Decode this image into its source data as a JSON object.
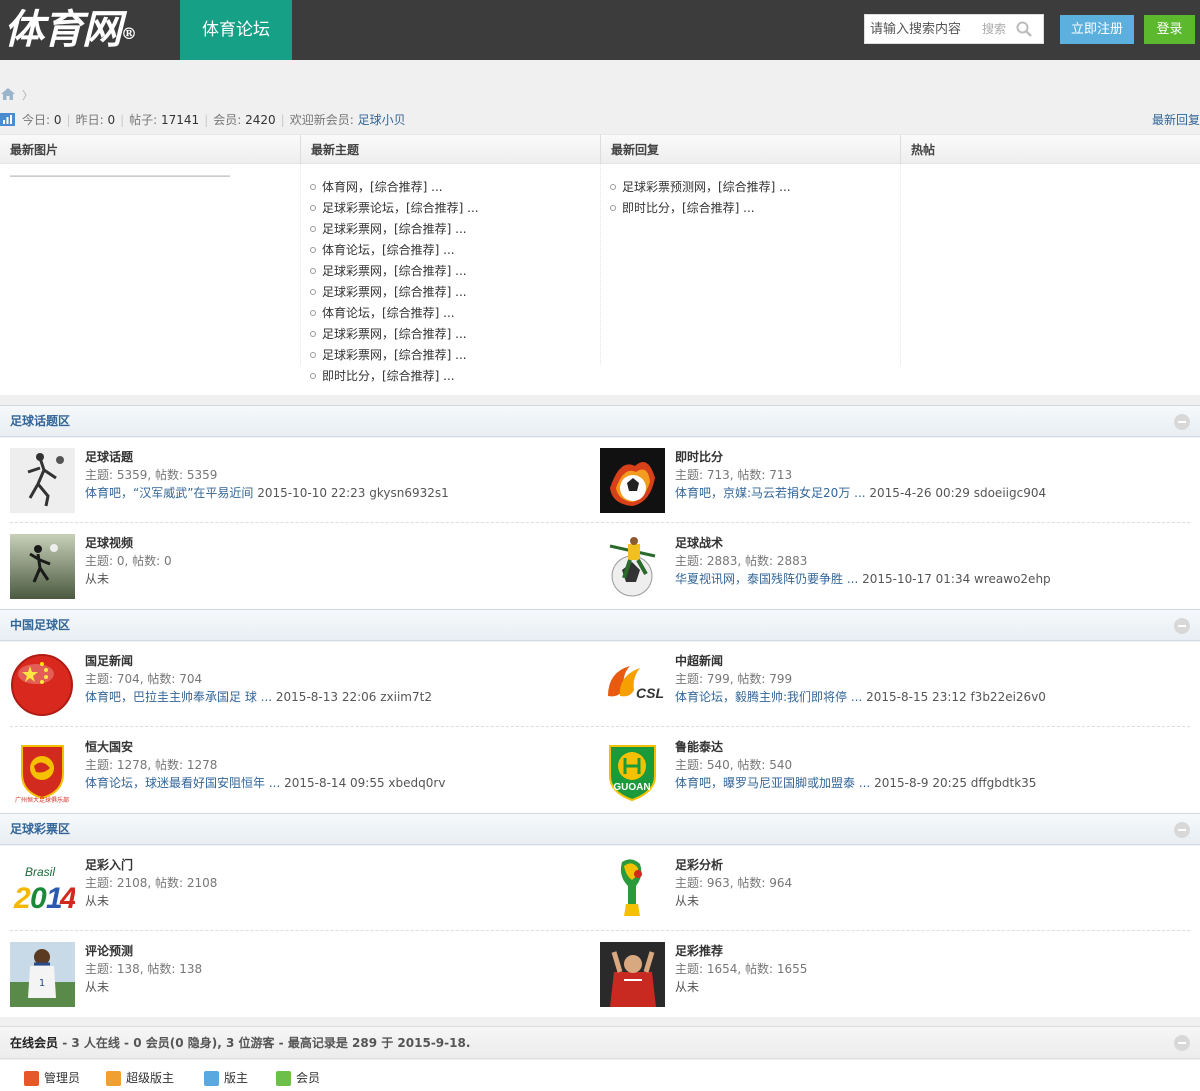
{
  "header": {
    "logo": "体育网",
    "logo_mark": "®",
    "nav_tab": "体育论坛",
    "search_placeholder": "请输入搜索内容",
    "search_label": "搜索",
    "register_label": "立即注册",
    "login_label": "登录"
  },
  "breadcrumb": {
    "separator": "〉"
  },
  "stats": {
    "today_label": "今日:",
    "today": "0",
    "yesterday_label": "昨日:",
    "yesterday": "0",
    "posts_label": "帖子:",
    "posts": "17141",
    "members_label": "会员:",
    "members": "2420",
    "newest_label": "欢迎新会员:",
    "newest_member": "足球小贝",
    "latest_replies_link": "最新回复"
  },
  "portal": {
    "columns": [
      {
        "title": "最新图片",
        "items": []
      },
      {
        "title": "最新主题",
        "items": [
          "体育网，[综合推荐] ...",
          "足球彩票论坛，[综合推荐] ...",
          "足球彩票网，[综合推荐] ...",
          "体育论坛，[综合推荐] ...",
          "足球彩票网，[综合推荐] ...",
          "足球彩票网，[综合推荐] ...",
          "体育论坛，[综合推荐] ...",
          "足球彩票网，[综合推荐] ...",
          "足球彩票网，[综合推荐] ...",
          "即时比分，[综合推荐] ..."
        ]
      },
      {
        "title": "最新回复",
        "items": [
          "足球彩票预测网，[综合推荐] ...",
          "即时比分，[综合推荐] ..."
        ]
      },
      {
        "title": "热帖",
        "items": []
      }
    ]
  },
  "sections": [
    {
      "title": "足球话题区",
      "forums": [
        {
          "name": "足球话题",
          "stats": "主题: 5359, 帖数: 5359",
          "last_link": "体育吧，“汉军威武”在平易近间",
          "last_meta": "2015-10-10 22:23 gkysn6932s1",
          "icon": "soccer-player-sketch"
        },
        {
          "name": "即时比分",
          "stats": "主题: 713, 帖数: 713",
          "last_link": "体育吧，京媒:马云若捐女足20万 ...",
          "last_meta": "2015-4-26 00:29 sdoeiigc904",
          "icon": "flaming-ball"
        },
        {
          "name": "足球视频",
          "stats": "主题: 0, 帖数: 0",
          "last_link": "",
          "last_meta": "从未",
          "icon": "player-silhouette"
        },
        {
          "name": "足球战术",
          "stats": "主题: 2883, 帖数: 2883",
          "last_link": "华夏视讯网，泰国残阵仍要争胜 ...",
          "last_meta": "2015-10-17 01:34 wreawo2ehp",
          "icon": "player-kick"
        }
      ]
    },
    {
      "title": "中国足球区",
      "forums": [
        {
          "name": "国足新闻",
          "stats": "主题: 704, 帖数: 704",
          "last_link": "体育吧，巴拉圭主帅奉承国足 球 ...",
          "last_meta": "2015-8-13 22:06 zxiim7t2",
          "icon": "china-flag-ball"
        },
        {
          "name": "中超新闻",
          "stats": "主题: 799, 帖数: 799",
          "last_link": "体育论坛，毅腾主帅:我们即将停 ...",
          "last_meta": "2015-8-15 23:12 f3b22ei26v0",
          "icon": "csl-logo",
          "icon_text": "CSL"
        },
        {
          "name": "恒大国安",
          "stats": "主题: 1278, 帖数: 1278",
          "last_link": "体育论坛，球迷最看好国安阻恒年 ...",
          "last_meta": "2015-8-14 09:55 xbedq0rv",
          "icon": "evergrande-crest",
          "icon_text": "广州恒大足球俱乐部"
        },
        {
          "name": "鲁能泰达",
          "stats": "主题: 540, 帖数: 540",
          "last_link": "体育吧，曝罗马尼亚国脚或加盟泰 ...",
          "last_meta": "2015-8-9 20:25 dffgbdtk35",
          "icon": "guoan-crest",
          "icon_text": "GUOAN"
        }
      ]
    },
    {
      "title": "足球彩票区",
      "forums": [
        {
          "name": "足彩入门",
          "stats": "主题: 2108, 帖数: 2108",
          "last_link": "",
          "last_meta": "从未",
          "icon": "brasil-2014-logo",
          "icon_text": "Brasil",
          "icon_year": "2014"
        },
        {
          "name": "足彩分析",
          "stats": "主题: 963, 帖数: 964",
          "last_link": "",
          "last_meta": "从未",
          "icon": "world-cup-logo"
        },
        {
          "name": "评论预测",
          "stats": "主题: 138, 帖数: 138",
          "last_link": "",
          "last_meta": "从未",
          "icon": "player-photo"
        },
        {
          "name": "足彩推荐",
          "stats": "主题: 1654, 帖数: 1655",
          "last_link": "",
          "last_meta": "从未",
          "icon": "player-applause"
        }
      ]
    }
  ],
  "online": {
    "label": "在线会员",
    "summary": " - 3 人在线 - 0 会员(0 隐身), 3 位游客 - 最高记录是 289 于 2015-9-18.",
    "legend": [
      {
        "label": "管理员",
        "color": "#e8572a"
      },
      {
        "label": "超级版主",
        "color": "#f0a030"
      },
      {
        "label": "版主",
        "color": "#5aa8e0"
      },
      {
        "label": "会员",
        "color": "#6cc04a"
      }
    ]
  }
}
